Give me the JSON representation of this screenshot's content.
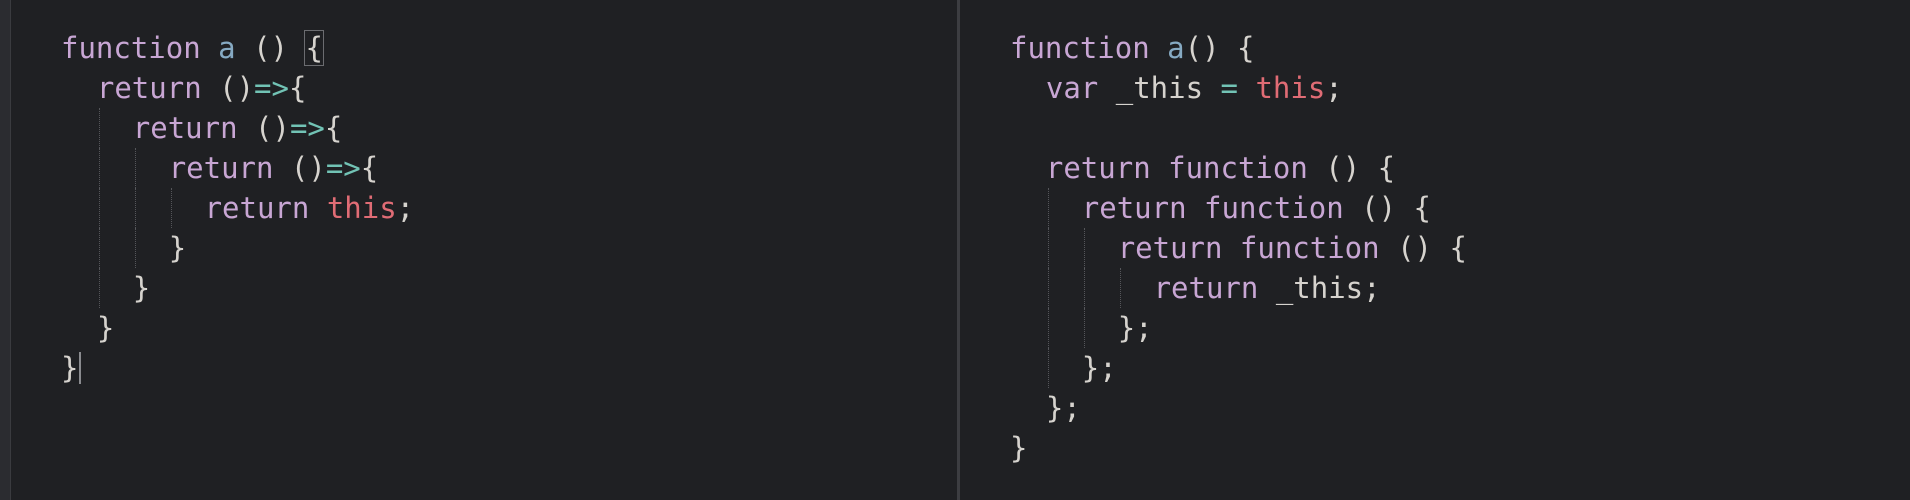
{
  "colors": {
    "background": "#1f2023",
    "keyword": "#c8a6d4",
    "function_name": "#86aac3",
    "this": "#e06c75",
    "arrow": "#72c3b5",
    "plain": "#d6d3ce"
  },
  "left_editor": {
    "lines": [
      {
        "indent": 0,
        "tokens": [
          {
            "t": "function",
            "c": "kw"
          },
          {
            "t": " ",
            "c": "plain"
          },
          {
            "t": "a",
            "c": "fn"
          },
          {
            "t": " () ",
            "c": "plain"
          },
          {
            "t": "{",
            "c": "bracket"
          }
        ]
      },
      {
        "indent": 1,
        "tokens": [
          {
            "t": "return",
            "c": "kw"
          },
          {
            "t": " ()",
            "c": "plain"
          },
          {
            "t": "=>",
            "c": "arrow"
          },
          {
            "t": "{",
            "c": "plain"
          }
        ]
      },
      {
        "indent": 2,
        "tokens": [
          {
            "t": "return",
            "c": "kw"
          },
          {
            "t": " ()",
            "c": "plain"
          },
          {
            "t": "=>",
            "c": "arrow"
          },
          {
            "t": "{",
            "c": "plain"
          }
        ]
      },
      {
        "indent": 3,
        "tokens": [
          {
            "t": "return",
            "c": "kw"
          },
          {
            "t": " ()",
            "c": "plain"
          },
          {
            "t": "=>",
            "c": "arrow"
          },
          {
            "t": "{",
            "c": "plain"
          }
        ]
      },
      {
        "indent": 4,
        "tokens": [
          {
            "t": "return",
            "c": "kw"
          },
          {
            "t": " ",
            "c": "plain"
          },
          {
            "t": "this",
            "c": "this"
          },
          {
            "t": ";",
            "c": "plain"
          }
        ]
      },
      {
        "indent": 3,
        "tokens": [
          {
            "t": "}",
            "c": "plain"
          }
        ]
      },
      {
        "indent": 2,
        "tokens": [
          {
            "t": "}",
            "c": "plain"
          }
        ]
      },
      {
        "indent": 1,
        "tokens": [
          {
            "t": "}",
            "c": "plain"
          }
        ]
      },
      {
        "indent": 0,
        "tokens": [
          {
            "t": "}",
            "c": "plain"
          }
        ]
      }
    ]
  },
  "right_editor": {
    "lines": [
      {
        "indent": 0,
        "tokens": [
          {
            "t": "function",
            "c": "kw"
          },
          {
            "t": " ",
            "c": "plain"
          },
          {
            "t": "a",
            "c": "fn"
          },
          {
            "t": "() {",
            "c": "plain"
          }
        ]
      },
      {
        "indent": 1,
        "tokens": [
          {
            "t": "var",
            "c": "kw"
          },
          {
            "t": " _this ",
            "c": "plain"
          },
          {
            "t": "=",
            "c": "arrow"
          },
          {
            "t": " ",
            "c": "plain"
          },
          {
            "t": "this",
            "c": "this"
          },
          {
            "t": ";",
            "c": "plain"
          }
        ]
      },
      {
        "indent": 0,
        "tokens": []
      },
      {
        "indent": 1,
        "tokens": [
          {
            "t": "return",
            "c": "kw"
          },
          {
            "t": " ",
            "c": "plain"
          },
          {
            "t": "function",
            "c": "kw"
          },
          {
            "t": " () {",
            "c": "plain"
          }
        ]
      },
      {
        "indent": 2,
        "tokens": [
          {
            "t": "return",
            "c": "kw"
          },
          {
            "t": " ",
            "c": "plain"
          },
          {
            "t": "function",
            "c": "kw"
          },
          {
            "t": " () {",
            "c": "plain"
          }
        ]
      },
      {
        "indent": 3,
        "tokens": [
          {
            "t": "return",
            "c": "kw"
          },
          {
            "t": " ",
            "c": "plain"
          },
          {
            "t": "function",
            "c": "kw"
          },
          {
            "t": " () {",
            "c": "plain"
          }
        ]
      },
      {
        "indent": 4,
        "tokens": [
          {
            "t": "return",
            "c": "kw"
          },
          {
            "t": " _this;",
            "c": "plain"
          }
        ]
      },
      {
        "indent": 3,
        "tokens": [
          {
            "t": "};",
            "c": "plain"
          }
        ]
      },
      {
        "indent": 2,
        "tokens": [
          {
            "t": "};",
            "c": "plain"
          }
        ]
      },
      {
        "indent": 1,
        "tokens": [
          {
            "t": "};",
            "c": "plain"
          }
        ]
      },
      {
        "indent": 0,
        "tokens": [
          {
            "t": "}",
            "c": "plain"
          }
        ]
      }
    ]
  }
}
